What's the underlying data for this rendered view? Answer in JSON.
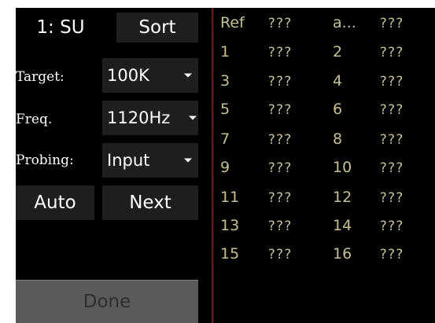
{
  "header": {
    "mode_label": "1: SU",
    "sort_label": "Sort"
  },
  "settings": {
    "target": {
      "label": "Target:",
      "value": "100K"
    },
    "freq": {
      "label": "Freq.",
      "value": "1120Hz"
    },
    "probing": {
      "label": "Probing:",
      "value": "Input"
    }
  },
  "actions": {
    "auto_label": "Auto",
    "next_label": "Next",
    "done_label": "Done"
  },
  "table": {
    "header": [
      "Ref",
      "???",
      "a...",
      "???"
    ],
    "rows": [
      [
        "1",
        "???",
        "2",
        "???"
      ],
      [
        "3",
        "???",
        "4",
        "???"
      ],
      [
        "5",
        "???",
        "6",
        "???"
      ],
      [
        "7",
        "???",
        "8",
        "???"
      ],
      [
        "9",
        "???",
        "10",
        "???"
      ],
      [
        "11",
        "???",
        "12",
        "???"
      ],
      [
        "13",
        "???",
        "14",
        "???"
      ],
      [
        "15",
        "???",
        "16",
        "???"
      ]
    ]
  },
  "colors": {
    "background": "#000000",
    "button_bg": "#1e1e1e",
    "done_bg": "#5a5a5a",
    "table_text": "#c8c08a",
    "separator": "#7a1414"
  }
}
